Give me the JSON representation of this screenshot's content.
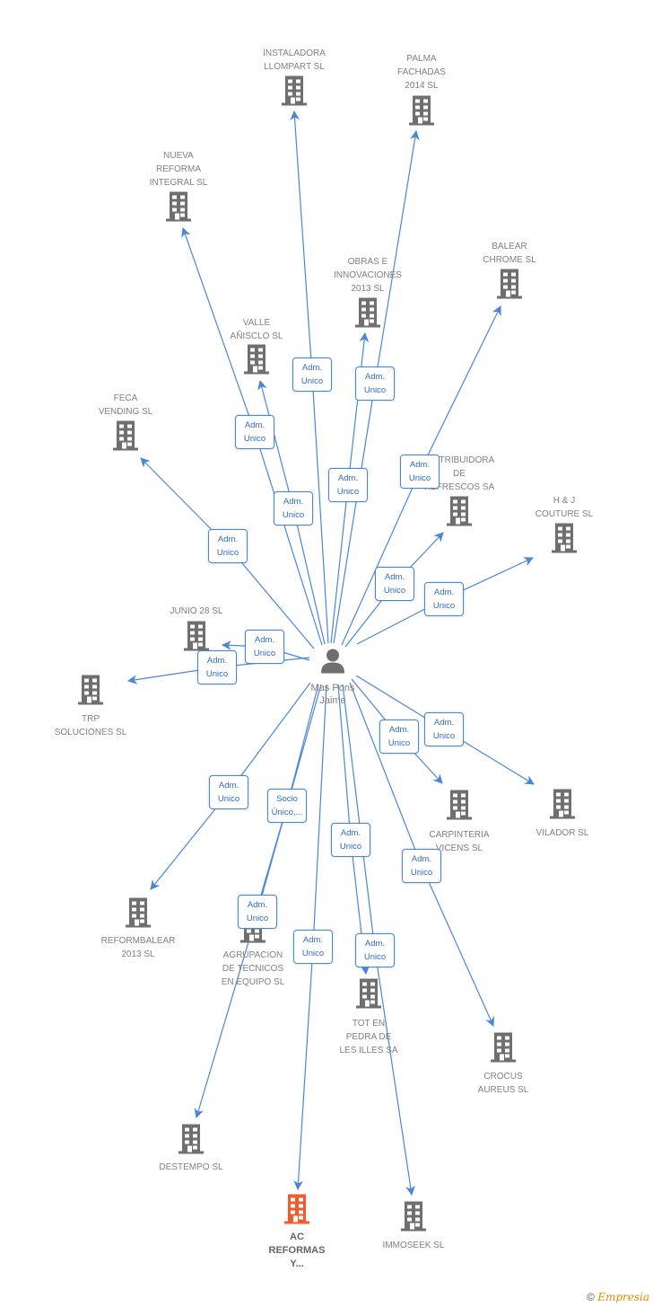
{
  "center": {
    "name": "Mas Pons\nJaime",
    "icon": "person-icon"
  },
  "colors": {
    "edge": "#4a86d8",
    "building": "#6f6f6f",
    "highlight": "#f15a2b",
    "label": "#808080"
  },
  "nodes": [
    {
      "id": "instaladora",
      "label": "INSTALADORA\nLLOMPART  SL",
      "relation": "Adm.\nUnico"
    },
    {
      "id": "palma",
      "label": "PALMA\nFACHADAS\n2014  SL",
      "relation": "Adm.\nUnico"
    },
    {
      "id": "nueva",
      "label": "NUEVA\nREFORMA\nINTEGRAL SL",
      "relation": "Adm.\nUnico"
    },
    {
      "id": "balear",
      "label": "BALEAR\nCHROME SL",
      "relation": "Adm.\nUnico"
    },
    {
      "id": "obras",
      "label": "OBRAS E\nINNOVACIONES\n2013 SL",
      "relation": "Adm.\nUnico"
    },
    {
      "id": "valle",
      "label": "VALLE\nAÑISCLO SL",
      "relation": "Adm.\nUnico"
    },
    {
      "id": "feca",
      "label": "FECA\nVENDING  SL",
      "relation": "Adm.\nUnico"
    },
    {
      "id": "distribuidora",
      "label": "DISTRIBUIDORA\nDE\nREFRESCOS SA",
      "relation": "Adm.\nUnico"
    },
    {
      "id": "hj",
      "label": "H & J\nCOUTURE  SL",
      "relation": "Adm.\nUnico"
    },
    {
      "id": "junio",
      "label": "JUNIO 28 SL",
      "relation": "Adm.\nUnico"
    },
    {
      "id": "trp",
      "label": "TRP\nSOLUCIONES  SL",
      "relation": "Adm.\nUnico"
    },
    {
      "id": "carpinteria",
      "label": "CARPINTERIA\nVICENS SL",
      "relation": "Adm.\nUnico"
    },
    {
      "id": "vilador",
      "label": "VILADOR SL",
      "relation": "Adm.\nUnico"
    },
    {
      "id": "reformbalear",
      "label": "REFORMBALEAR\n2013 SL",
      "relation": "Adm.\nUnico"
    },
    {
      "id": "agrupacion",
      "label": "AGRUPACION\nDE TECNICOS\nEN EQUIPO SL",
      "relation": "Socio\nÚnico,..."
    },
    {
      "id": "tot",
      "label": "TOT EN\nPEDRA DE\nLES ILLES SA",
      "relation": "Adm.\nUnico"
    },
    {
      "id": "crocus",
      "label": "CROCUS\nAUREUS SL",
      "relation": "Adm.\nUnico"
    },
    {
      "id": "destempo",
      "label": "DESTEMPO SL",
      "relation": "Adm.\nUnico"
    },
    {
      "id": "ac",
      "label": "AC\nREFORMAS\nY...",
      "relation": "Adm.\nUnico",
      "highlight": true
    },
    {
      "id": "immoseek",
      "label": "IMMOSEEK SL",
      "relation": "Adm.\nUnico"
    },
    {
      "id": "agrupacion2",
      "label": "",
      "relation": "Adm.\nUnico"
    }
  ],
  "footer": {
    "copyright": "©",
    "brand": "Empresia"
  }
}
